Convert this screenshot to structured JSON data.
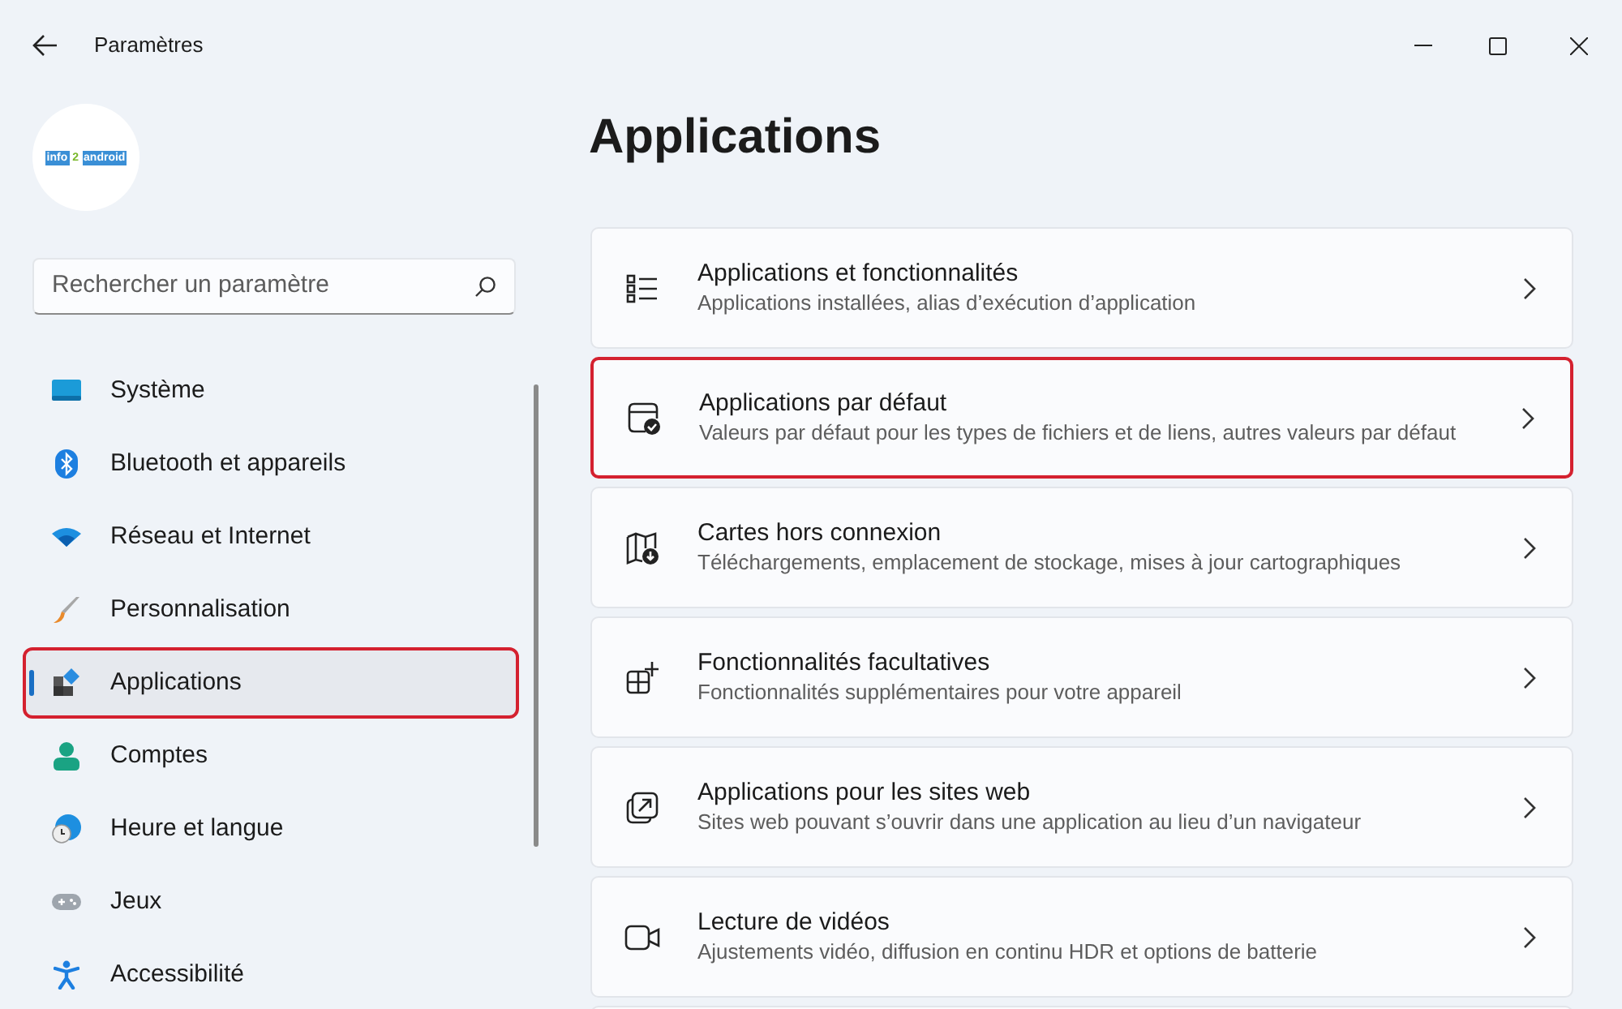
{
  "window": {
    "title": "Paramètres"
  },
  "account": {
    "logo_parts": [
      "info",
      "2",
      "android"
    ]
  },
  "search": {
    "placeholder": "Rechercher un paramètre"
  },
  "sidebar": {
    "items": [
      {
        "label": "Système",
        "selected": false,
        "highlighted": false
      },
      {
        "label": "Bluetooth et appareils",
        "selected": false,
        "highlighted": false
      },
      {
        "label": "Réseau et Internet",
        "selected": false,
        "highlighted": false
      },
      {
        "label": "Personnalisation",
        "selected": false,
        "highlighted": false
      },
      {
        "label": "Applications",
        "selected": true,
        "highlighted": true
      },
      {
        "label": "Comptes",
        "selected": false,
        "highlighted": false
      },
      {
        "label": "Heure et langue",
        "selected": false,
        "highlighted": false
      },
      {
        "label": "Jeux",
        "selected": false,
        "highlighted": false
      },
      {
        "label": "Accessibilité",
        "selected": false,
        "highlighted": false
      }
    ]
  },
  "page": {
    "title": "Applications",
    "cards": [
      {
        "title": "Applications et fonctionnalités",
        "subtitle": "Applications installées, alias d’exécution d’application",
        "highlighted": false
      },
      {
        "title": "Applications par défaut",
        "subtitle": "Valeurs par défaut pour les types de fichiers et de liens, autres valeurs par défaut",
        "highlighted": true
      },
      {
        "title": "Cartes hors connexion",
        "subtitle": "Téléchargements, emplacement de stockage, mises à jour cartographiques",
        "highlighted": false
      },
      {
        "title": "Fonctionnalités facultatives",
        "subtitle": "Fonctionnalités supplémentaires pour votre appareil",
        "highlighted": false
      },
      {
        "title": "Applications pour les sites web",
        "subtitle": "Sites web pouvant s’ouvrir dans une application au lieu d’un navigateur",
        "highlighted": false
      },
      {
        "title": "Lecture de vidéos",
        "subtitle": "Ajustements vidéo, diffusion en continu HDR et options de batterie",
        "highlighted": false
      }
    ]
  }
}
